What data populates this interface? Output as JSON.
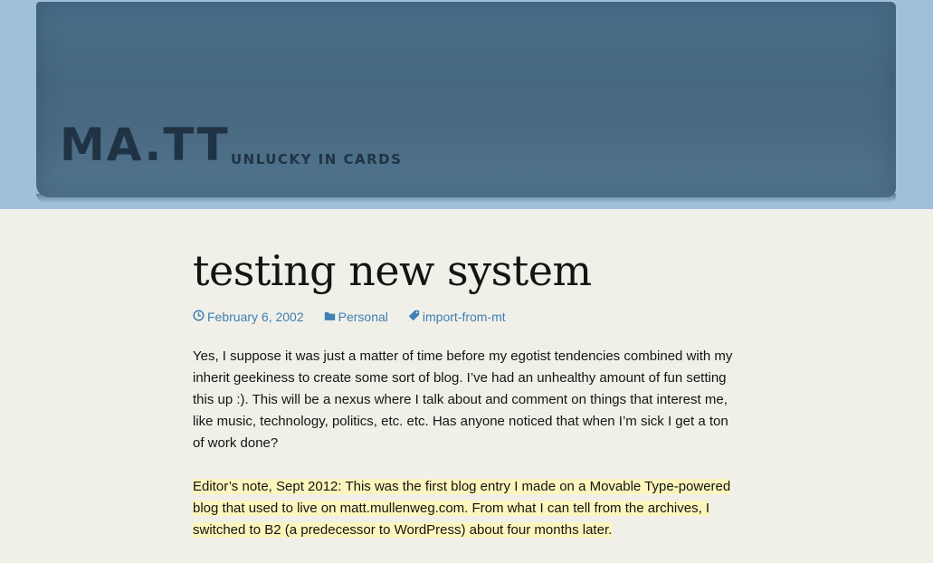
{
  "site": {
    "title": "MA.TT",
    "tagline": "UNLUCKY IN CARDS"
  },
  "post": {
    "title": "testing new  system",
    "meta": {
      "date": "February 6, 2002",
      "category": "Personal",
      "tag": "import-from-mt"
    },
    "paragraphs": [
      "Yes, I suppose it was just a matter of time before my egotist tendencies combined with my inherit geekiness to create some sort of blog. I’ve had an unhealthy amount of fun setting this up :). This will be a nexus where I talk about and comment on things that interest me, like music, technology, politics, etc. etc. Has anyone noticed that when I’m sick I get a ton of work done?"
    ],
    "editor_note": "Editor’s note, Sept 2012: This was the first blog entry I made on a Movable Type-powered blog that used to live on matt.mullenweg.com. From what I can tell from the archives, I switched to B2 (a predecessor to WordPress) about four months later."
  },
  "colors": {
    "header_bg": "#9fc0da",
    "header_panel": "#4b6f8b",
    "link": "#3e7fb4",
    "highlight": "#fcf5bd",
    "page_bg": "#f1f0e8"
  }
}
